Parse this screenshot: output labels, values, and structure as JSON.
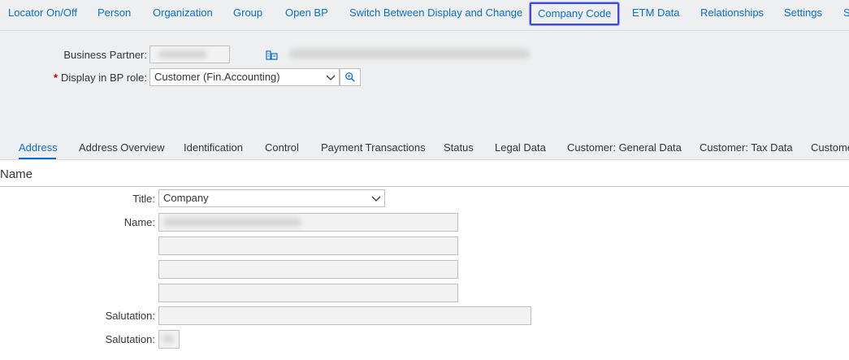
{
  "toolbar": {
    "items": [
      "Locator On/Off",
      "Person",
      "Organization",
      "Group",
      "Open BP",
      "Switch Between Display and Change",
      "Company Code",
      "ETM Data",
      "Relationships",
      "Settings",
      "S"
    ]
  },
  "header": {
    "bp_label": "Business Partner:",
    "role_label": "Display in BP role:",
    "role_required": "*",
    "role_value": "Customer (Fin.Accounting)"
  },
  "tabs": [
    "Address",
    "Address Overview",
    "Identification",
    "Control",
    "Payment Transactions",
    "Status",
    "Legal Data",
    "Customer: General Data",
    "Customer: Tax Data",
    "Custome"
  ],
  "section": {
    "title": "Name",
    "title_label": "Title:",
    "title_value": "Company",
    "name_label": "Name:",
    "salutation_label": "Salutation:",
    "salutation2_label": "Salutation:"
  },
  "icons": {
    "bp_icon": "business-partner-icon",
    "search": "search-icon",
    "dropdown": "chevron-down-icon"
  },
  "colors": {
    "link": "#0a6ed1",
    "focus": "#3f4bd8",
    "required": "#bb0000",
    "header_bg": "#edeff0"
  }
}
